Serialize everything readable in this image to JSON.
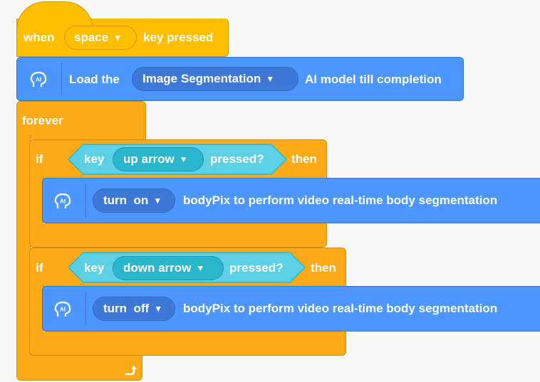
{
  "hat": {
    "when": "when",
    "key_option": "space",
    "key_pressed": "key pressed"
  },
  "load": {
    "prefix": "Load the",
    "model_option": "Image Segmentation",
    "suffix": "AI model till completion"
  },
  "forever": {
    "label": "forever"
  },
  "if1": {
    "if": "if",
    "key": "key",
    "key_option": "up arrow",
    "pressed": "pressed?",
    "then": "then",
    "action_option": "turn  on",
    "action_text": "bodyPix to perform video real-time body segmentation"
  },
  "if2": {
    "if": "if",
    "key": "key",
    "key_option": "down arrow",
    "pressed": "pressed?",
    "then": "then",
    "action_option": "turn  off",
    "action_text": "bodyPix to perform video real-time body segmentation"
  },
  "icons": {
    "ai": "ai-head-icon",
    "dropdown": "dropdown-arrow-icon",
    "loop": "loop-arrow-icon"
  },
  "colors": {
    "event": "#ffbf00",
    "control": "#ffab19",
    "ai_extension": "#4c97ff",
    "sensing": "#5cb1d6"
  }
}
